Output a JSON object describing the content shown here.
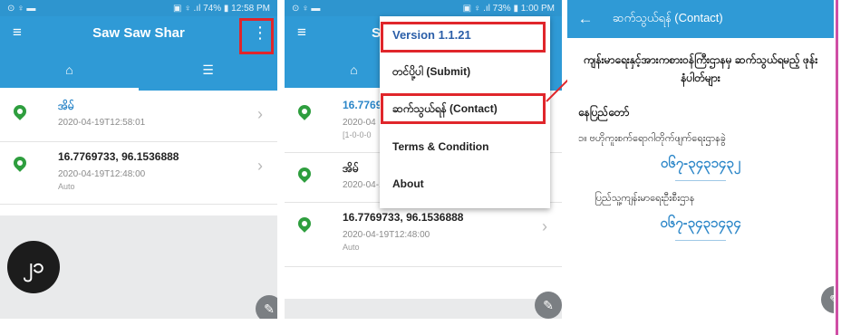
{
  "screen1": {
    "status": {
      "left": "⊙ ♀ ▬",
      "right": "▣ ♀ .ıl 74% ▮ 12:58 PM"
    },
    "appbar": {
      "title": "Saw Saw Shar"
    },
    "icons": {
      "menu": "≡",
      "overflow": "⋮",
      "home": "⌂",
      "list": "☰"
    },
    "rows": [
      {
        "line1": "အိမ်",
        "line2": "2020-04-19T12:58:01",
        "line3": ""
      },
      {
        "line1": "16.7769733, 96.1536888",
        "line2": "2020-04-19T12:48:00",
        "line3": "Auto"
      }
    ],
    "logo": "၂၁"
  },
  "screen2": {
    "status": {
      "left": "⊙ ♀ ▬",
      "right": "▣ ♀ .ıl 73% ▮ 1:00 PM"
    },
    "appbar": {
      "title_partial": "S"
    },
    "rows": [
      {
        "line1": "16.7769",
        "line2": "2020-04",
        "line3": "[1-0-0-0"
      },
      {
        "line1": "အိမ်",
        "line2": "2020-04-19T12:58:01",
        "line3": ""
      },
      {
        "line1": "16.7769733, 96.1536888",
        "line2": "2020-04-19T12:48:00",
        "line3": "Auto"
      }
    ],
    "menu_items": [
      "Version 1.1.21",
      "တင်ပို့ပါ (Submit)",
      "ဆက်သွယ်ရန် (Contact)",
      "Terms & Condition",
      "About"
    ]
  },
  "screen3": {
    "header": {
      "title": "ဆက်သွယ်ရန် (Contact)"
    },
    "intro": "ကျန်းမာရေးနှင့်အားကစားဝန်ကြီးဌာနမှ ဆက်သွယ်ရမည့် ဖုန်းနံပါတ်များ",
    "section": "နေပြည်တော်",
    "line_a": "၁။ ဗဟိုကူးစက်ရောဂါတိုက်ဖျက်ရေးဌာနခွဲ",
    "phone_a": "၀၆၇-၃၄၃၁၄၃၂",
    "line_b": "ပြည်သူ့ကျန်းမာရေးဦးစီးဌာန",
    "phone_b": "၀၆၇-၃၄၃၁၄၃၄"
  },
  "colors": {
    "primary": "#2f9ad6",
    "highlight": "#e0262b",
    "pin": "#2e9e3e",
    "link": "#2b86c8",
    "rule": "#cf4fa5"
  }
}
